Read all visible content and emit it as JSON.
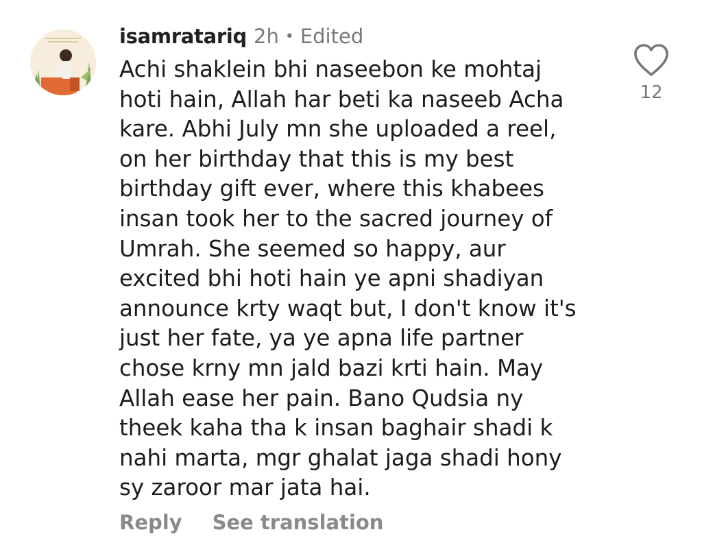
{
  "comment": {
    "username": "isamratariq",
    "time": "2h",
    "edited_label": "Edited",
    "separator": "•",
    "lines": [
      "Achi shaklein bhi naseebon ke mohtaj",
      "hoti hain, Allah har beti ka naseeb Acha",
      "kare. Abhi July mn she uploaded a reel,",
      "on her birthday that this is my best",
      "birthday gift ever, where this khabees",
      "insan took her to the sacred journey of",
      "Umrah. She seemed so happy, aur",
      "excited bhi hoti hain ye apni shadiyan",
      "announce krty waqt but, I don't know it's",
      "just her fate, ya ye apna life partner",
      "chose krny mn jald bazi krti hain. May",
      "Allah ease her pain. Bano Qudsia ny",
      "theek kaha tha k insan baghair shadi k",
      "nahi marta, mgr ghalat jaga shadi hony",
      "sy zaroor mar jata hai."
    ],
    "like_count": "12",
    "like_icon": "heart-outline-icon",
    "actions": {
      "reply_label": "Reply",
      "translate_label": "See translation"
    }
  },
  "colors": {
    "text": "#1c1c1c",
    "muted": "#777777",
    "action": "#8a8a8a"
  }
}
